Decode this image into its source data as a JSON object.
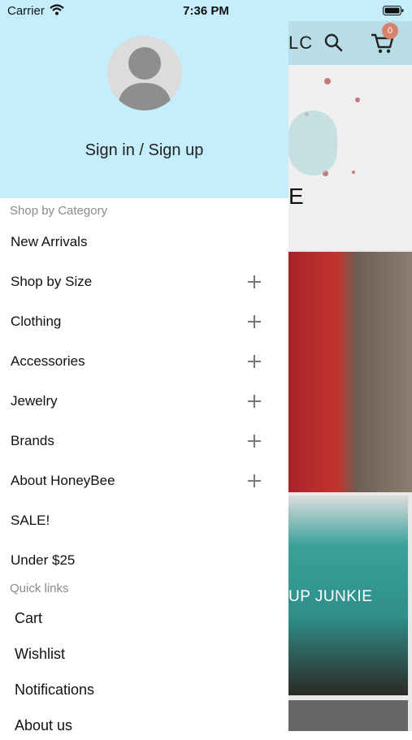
{
  "status_bar": {
    "carrier": "Carrier",
    "time": "7:36 PM",
    "wifi_icon": "wifi-icon",
    "battery_icon": "battery-icon"
  },
  "background_app": {
    "header_title_fragment": "LC",
    "cart_badge_count": "0",
    "banner_fragment": "E",
    "promo_text_fragment": "UP JUNKIE",
    "header_color": "#b9dde6",
    "badge_color": "#d9826b"
  },
  "drawer": {
    "header_color": "#c4eefb",
    "avatar_icon": "user-avatar-icon",
    "sign_in_label": "Sign in / Sign up",
    "shop_section_title": "Shop by Category",
    "categories": [
      {
        "label": "New Arrivals",
        "expandable": false
      },
      {
        "label": "Shop by Size",
        "expandable": true
      },
      {
        "label": "Clothing",
        "expandable": true
      },
      {
        "label": "Accessories",
        "expandable": true
      },
      {
        "label": "Jewelry",
        "expandable": true
      },
      {
        "label": "Brands",
        "expandable": true
      },
      {
        "label": "About HoneyBee",
        "expandable": true
      },
      {
        "label": "SALE!",
        "expandable": false
      },
      {
        "label": "Under $25",
        "expandable": false
      }
    ],
    "quick_links_title": "Quick links",
    "quick_links": [
      {
        "label": "Cart"
      },
      {
        "label": "Wishlist"
      },
      {
        "label": "Notifications"
      },
      {
        "label": "About us"
      }
    ]
  }
}
